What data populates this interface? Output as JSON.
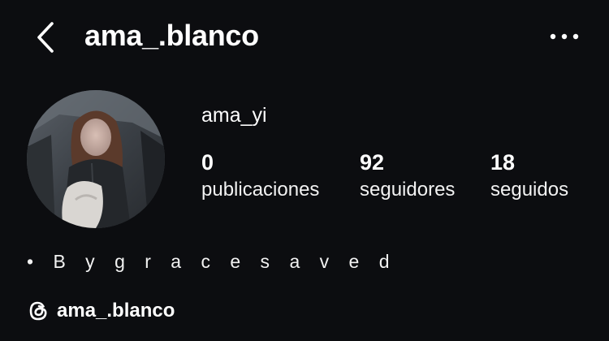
{
  "header": {
    "username": "ama_.blanco",
    "back_icon": "chevron-left-icon",
    "more_icon": "more-horizontal-icon"
  },
  "profile": {
    "display_name": "ama_yi",
    "stats": [
      {
        "count": "0",
        "label": "publicaciones"
      },
      {
        "count": "92",
        "label": "seguidores"
      },
      {
        "count": "18",
        "label": "seguidos"
      }
    ],
    "bio": "• B y g r a c e s a v e d",
    "threads": {
      "icon": "threads-icon",
      "handle": "ama_.blanco"
    }
  },
  "colors": {
    "background": "#0c0d10",
    "text": "#ffffff"
  }
}
